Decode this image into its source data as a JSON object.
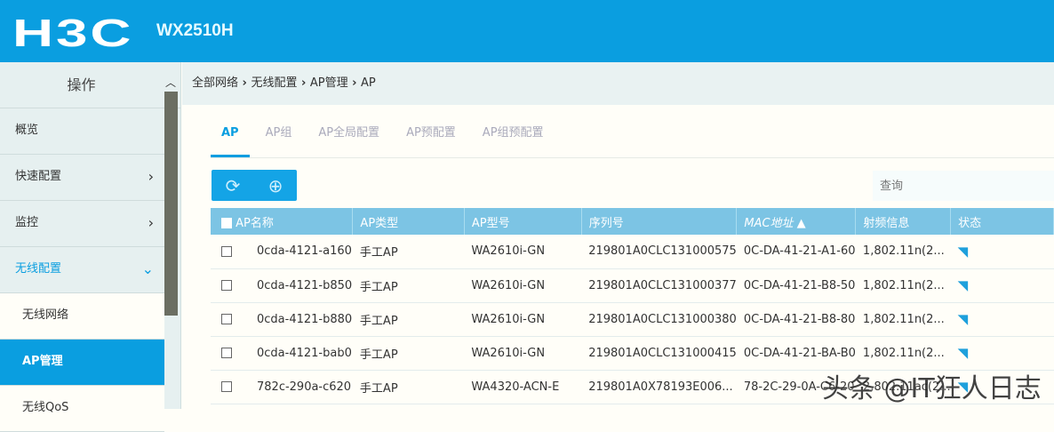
{
  "header": {
    "logo": "H3C",
    "model": "WX2510H"
  },
  "sidebar": {
    "title": "操作",
    "items": [
      {
        "label": "概览",
        "chevron": ""
      },
      {
        "label": "快速配置",
        "chevron": "›"
      },
      {
        "label": "监控",
        "chevron": "›"
      },
      {
        "label": "无线配置",
        "chevron": "⌄"
      },
      {
        "label": "无线网络",
        "chevron": ""
      },
      {
        "label": "AP管理",
        "chevron": ""
      },
      {
        "label": "无线QoS",
        "chevron": ""
      }
    ]
  },
  "breadcrumb": [
    "全部网络",
    "无线配置",
    "AP管理",
    "AP"
  ],
  "tabs": [
    "AP",
    "AP组",
    "AP全局配置",
    "AP预配置",
    "AP组预配置"
  ],
  "search": {
    "placeholder": "查询"
  },
  "table": {
    "headers": [
      "AP名称",
      "AP类型",
      "AP型号",
      "序列号",
      "MAC地址 ▲",
      "射频信息",
      "状态"
    ],
    "rows": [
      [
        "0cda-4121-a160",
        "手工AP",
        "WA2610i-GN",
        "219801A0CLC131000575",
        "0C-DA-41-21-A1-60",
        "1,802.11n(2..."
      ],
      [
        "0cda-4121-b850",
        "手工AP",
        "WA2610i-GN",
        "219801A0CLC131000377",
        "0C-DA-41-21-B8-50",
        "1,802.11n(2..."
      ],
      [
        "0cda-4121-b880",
        "手工AP",
        "WA2610i-GN",
        "219801A0CLC131000380",
        "0C-DA-41-21-B8-80",
        "1,802.11n(2..."
      ],
      [
        "0cda-4121-bab0",
        "手工AP",
        "WA2610i-GN",
        "219801A0CLC131000415",
        "0C-DA-41-21-BA-B0",
        "1,802.11n(2..."
      ],
      [
        "782c-290a-c620",
        "手工AP",
        "WA4320-ACN-E",
        "219801A0X78193E006...",
        "78-2C-29-0A-C6-20",
        "2,802.11ac(2..."
      ]
    ]
  },
  "watermark": "头条 @IT狂人日志",
  "colors": {
    "brand": "#0a9ee0",
    "table_header": "#7cc4e4"
  }
}
